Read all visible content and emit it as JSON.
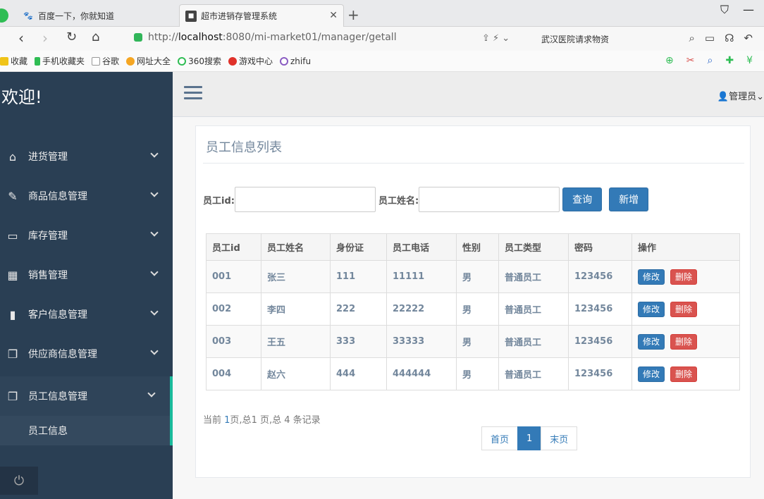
{
  "browser": {
    "tabs": [
      {
        "title": "百度一下，你就知道",
        "favicon": "paw-icon"
      },
      {
        "title": "超市进销存管理系统",
        "favicon": "app-icon"
      }
    ],
    "url_prefix": "http://",
    "url_host": "localhost",
    "url_rest": ":8080/mi-market01/manager/getall",
    "search_hint": "武汉医院请求物资",
    "bookmarks": [
      "收藏",
      "手机收藏夹",
      "谷歌",
      "网址大全",
      "360搜索",
      "游戏中心",
      "zhifu"
    ]
  },
  "sidebar": {
    "welcome": "欢迎!",
    "items": [
      {
        "label": "进货管理",
        "icon": "home-icon"
      },
      {
        "label": "商品信息管理",
        "icon": "edit-icon"
      },
      {
        "label": "库存管理",
        "icon": "desktop-icon"
      },
      {
        "label": "销售管理",
        "icon": "table-icon"
      },
      {
        "label": "客户信息管理",
        "icon": "bar-chart-icon"
      },
      {
        "label": "供应商信息管理",
        "icon": "clone-icon"
      },
      {
        "label": "员工信息管理",
        "icon": "clone-icon"
      }
    ],
    "submenu": "员工信息"
  },
  "topbar": {
    "user": "管理员"
  },
  "panel": {
    "title": "员工信息列表",
    "search": {
      "id_label": "员工id:",
      "name_label": "员工姓名:",
      "query_btn": "查询",
      "add_btn": "新增"
    },
    "columns": [
      "员工id",
      "员工姓名",
      "身份证",
      "员工电话",
      "性别",
      "员工类型",
      "密码",
      "操作"
    ],
    "rows": [
      [
        "001",
        "张三",
        "111",
        "11111",
        "男",
        "普通员工",
        "123456"
      ],
      [
        "002",
        "李四",
        "222",
        "22222",
        "男",
        "普通员工",
        "123456"
      ],
      [
        "003",
        "王五",
        "333",
        "33333",
        "男",
        "普通员工",
        "123456"
      ],
      [
        "004",
        "赵六",
        "444",
        "444444",
        "男",
        "普通员工",
        "123456"
      ]
    ],
    "edit_label": "修改",
    "delete_label": "删除",
    "page_info": {
      "before": "当前 ",
      "current": "1",
      "middle": "页,总",
      "total": "1",
      "after": " 页,总 4 条记录"
    },
    "pager": {
      "first": "首页",
      "page": "1",
      "last": "末页"
    }
  }
}
